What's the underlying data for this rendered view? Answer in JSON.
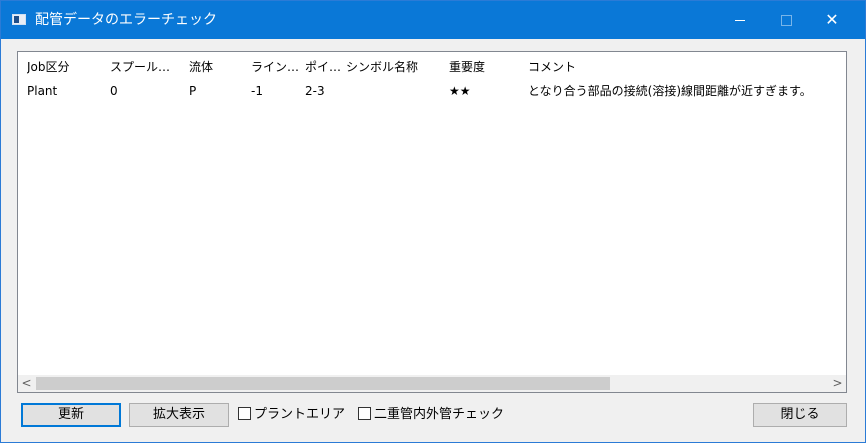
{
  "window": {
    "title": "配管データのエラーチェック",
    "controls": {
      "minimize": "—",
      "maximize": "□",
      "close": "✕"
    }
  },
  "table": {
    "columns": [
      "Job区分",
      "スプール…",
      "流体",
      "ライン…",
      "ポイ…",
      "シンボル名称",
      "重要度",
      "コメント"
    ],
    "rows": [
      {
        "job": "Plant",
        "spool": "0",
        "fluid": "P",
        "line": "-1",
        "point": "2-3",
        "symbol": "",
        "importance": "★★",
        "comment": "となり合う部品の接続(溶接)線間距離が近すぎます。"
      }
    ]
  },
  "scrollbar": {
    "left_arrow": "<",
    "right_arrow": ">"
  },
  "buttons": {
    "refresh": "更新",
    "zoom": "拡大表示",
    "close": "閉じる"
  },
  "checkboxes": {
    "plant_area": {
      "label": "プラントエリア",
      "checked": false
    },
    "double_pipe": {
      "label": "二重管内外管チェック",
      "checked": false
    }
  },
  "colors": {
    "titlebar": "#0a78d7",
    "accent": "#0078d7"
  }
}
